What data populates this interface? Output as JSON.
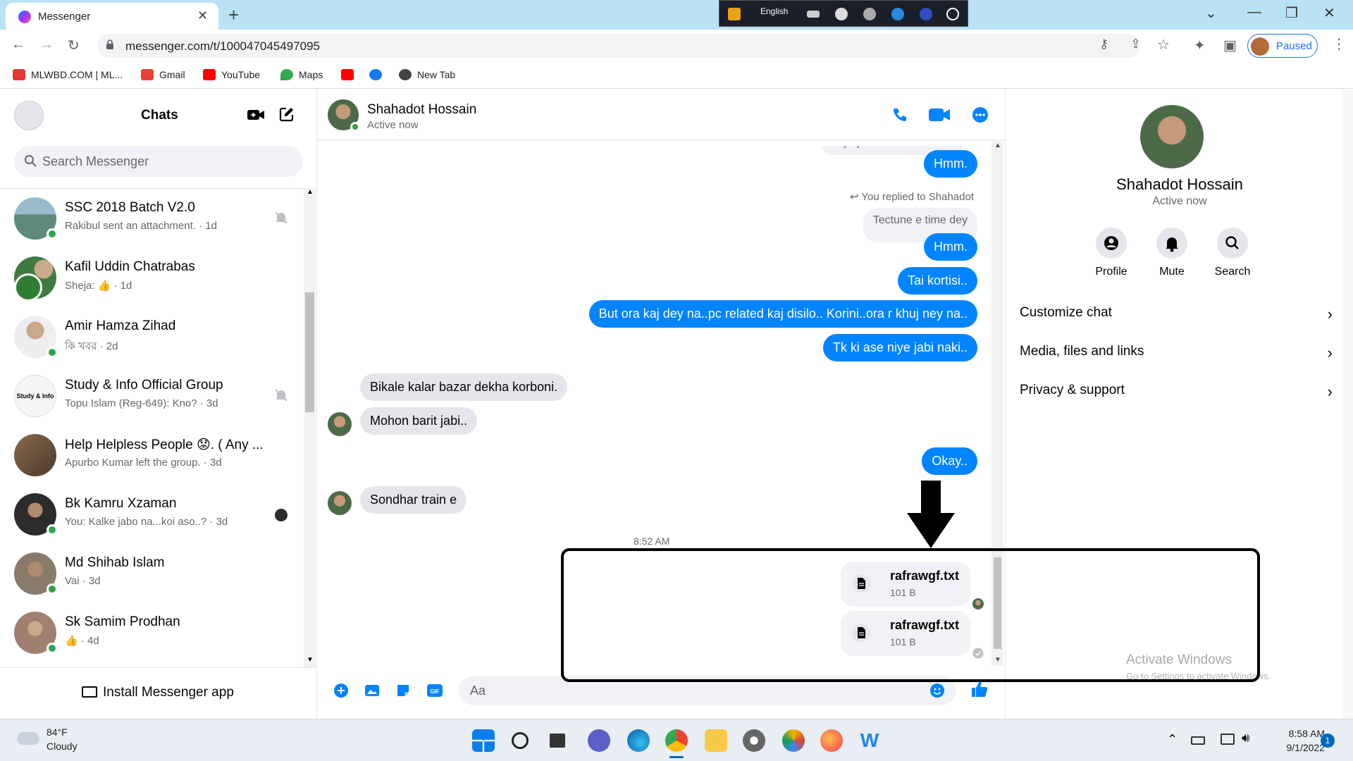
{
  "browser": {
    "tab_title": "Messenger",
    "ime_language": "English",
    "url": "messenger.com/t/100047045497095",
    "profile_status": "Paused",
    "bookmarks": [
      {
        "label": "MLWBD.COM | ML...",
        "color": "#e53935"
      },
      {
        "label": "Gmail",
        "color": "#ea4335"
      },
      {
        "label": "YouTube",
        "color": "#ff0000"
      },
      {
        "label": "Maps",
        "color": "#34a853"
      },
      {
        "label": "",
        "color": "#ff0000"
      },
      {
        "label": "",
        "color": "#1877f2"
      },
      {
        "label": "New Tab",
        "color": "#444444"
      }
    ]
  },
  "sidebar": {
    "title": "Chats",
    "search_placeholder": "Search Messenger",
    "install_label": "Install Messenger app",
    "chats": [
      {
        "name": "SSC 2018 Batch V2.0",
        "snippet": "Rakibul sent an attachment. · 1d",
        "online": true,
        "muted": true,
        "avatar_color": "#5d8a7a"
      },
      {
        "name": "Kafil Uddin Chatrabas",
        "snippet": "Sheja: 👍 · 1d",
        "online": false,
        "muted": false,
        "avatar_color": "#3f7a3f"
      },
      {
        "name": "Amir Hamza Zihad",
        "snippet": "কি খবর · 2d",
        "online": true,
        "muted": false,
        "avatar_color": "#c9a98a"
      },
      {
        "name": "Study & Info Official Group",
        "snippet": "Topu Islam (Reg-649): Kno? · 3d",
        "online": false,
        "muted": true,
        "avatar_color": "#f5f5f5"
      },
      {
        "name": "Help Helpless People 😟. ( Any ...",
        "snippet": "Apurbo Kumar left the group. · 3d",
        "online": false,
        "muted": false,
        "avatar_color": "#6b5a4a"
      },
      {
        "name": "Bk Kamru Xzaman",
        "snippet": "You: Kalke jabo na...koi aso..? · 3d",
        "online": true,
        "muted": false,
        "avatar_color": "#2c2c2c"
      },
      {
        "name": "Md Shihab Islam",
        "snippet": "Vai · 3d",
        "online": true,
        "muted": false,
        "avatar_color": "#8a7a6a"
      },
      {
        "name": "Sk Samim Prodhan",
        "snippet": "👍 · 4d",
        "online": true,
        "muted": false,
        "avatar_color": "#a08070"
      }
    ]
  },
  "conversation": {
    "name": "Shahadot Hossain",
    "status": "Active now",
    "cut_message": "Feye jabi...tension nis na..",
    "reply_note": "You replied to Shahadot",
    "quoted": "Tectune e time dey",
    "messages": [
      {
        "from": "me",
        "text": "Hmm."
      },
      {
        "from": "me",
        "text": "Hmm."
      },
      {
        "from": "me",
        "text": "Tai kortisi.."
      },
      {
        "from": "me",
        "text": "But ora kaj dey na..pc related kaj disilo.. Korini..ora r khuj ney na.."
      },
      {
        "from": "me",
        "text": "Tk ki ase niye jabi naki.."
      },
      {
        "from": "them",
        "text": "Bikale kalar bazar dekha korboni."
      },
      {
        "from": "them",
        "text": "Mohon barit jabi.."
      },
      {
        "from": "me",
        "text": "Okay.."
      },
      {
        "from": "them",
        "text": "Sondhar train e"
      }
    ],
    "timestamp": "8:52 AM",
    "files": [
      {
        "name": "rafrawgf.txt",
        "size": "101 B"
      },
      {
        "name": "rafrawgf.txt",
        "size": "101 B"
      }
    ],
    "composer_placeholder": "Aa"
  },
  "right_panel": {
    "name": "Shahadot Hossain",
    "status": "Active now",
    "actions": [
      "Profile",
      "Mute",
      "Search"
    ],
    "rows": [
      "Customize chat",
      "Media, files and links",
      "Privacy & support"
    ]
  },
  "watermark": {
    "line1": "Activate Windows",
    "line2": "Go to Settings to activate Windows."
  },
  "taskbar": {
    "temp": "84°F",
    "condition": "Cloudy",
    "time": "8:58 AM",
    "date": "9/1/2022",
    "notification_count": "1"
  },
  "colors": {
    "accent": "#0084ff",
    "online": "#31a24c"
  }
}
